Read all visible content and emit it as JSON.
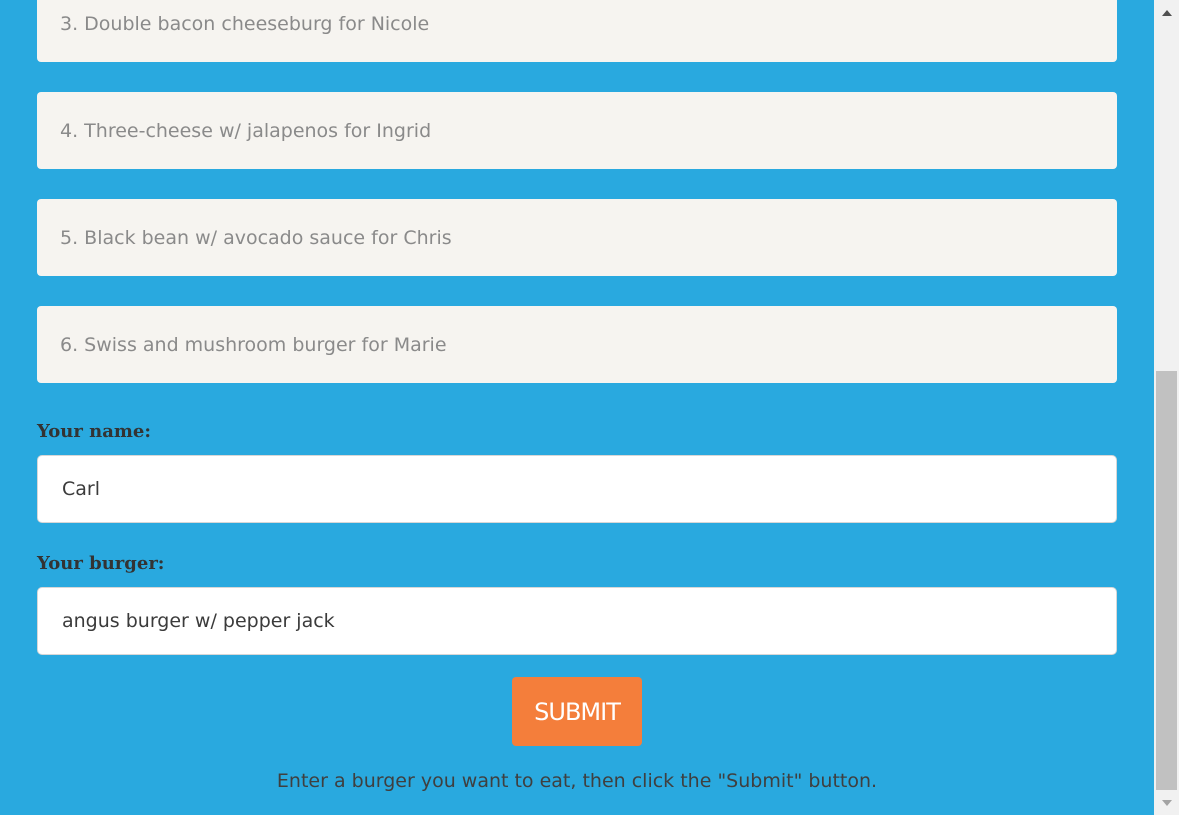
{
  "colors": {
    "page_background": "#29a9df",
    "order_item_background": "#f6f4f0",
    "submit_button": "#f47e3b"
  },
  "orders": [
    {
      "text": "3. Double bacon cheeseburg for Nicole"
    },
    {
      "text": "4. Three-cheese w/ jalapenos for Ingrid"
    },
    {
      "text": "5. Black bean w/ avocado sauce for Chris"
    },
    {
      "text": "6. Swiss and mushroom burger for Marie"
    }
  ],
  "form": {
    "name_label": "Your name:",
    "name_value": "Carl",
    "burger_label": "Your burger:",
    "burger_value": "angus burger w/ pepper jack",
    "submit_label": "SUBMIT"
  },
  "hint": "Enter a burger you want to eat, then click the \"Submit\" button.",
  "scrollbar": {
    "up_icon": "triangle-up-icon",
    "down_icon": "triangle-down-icon",
    "position": 1.0
  }
}
